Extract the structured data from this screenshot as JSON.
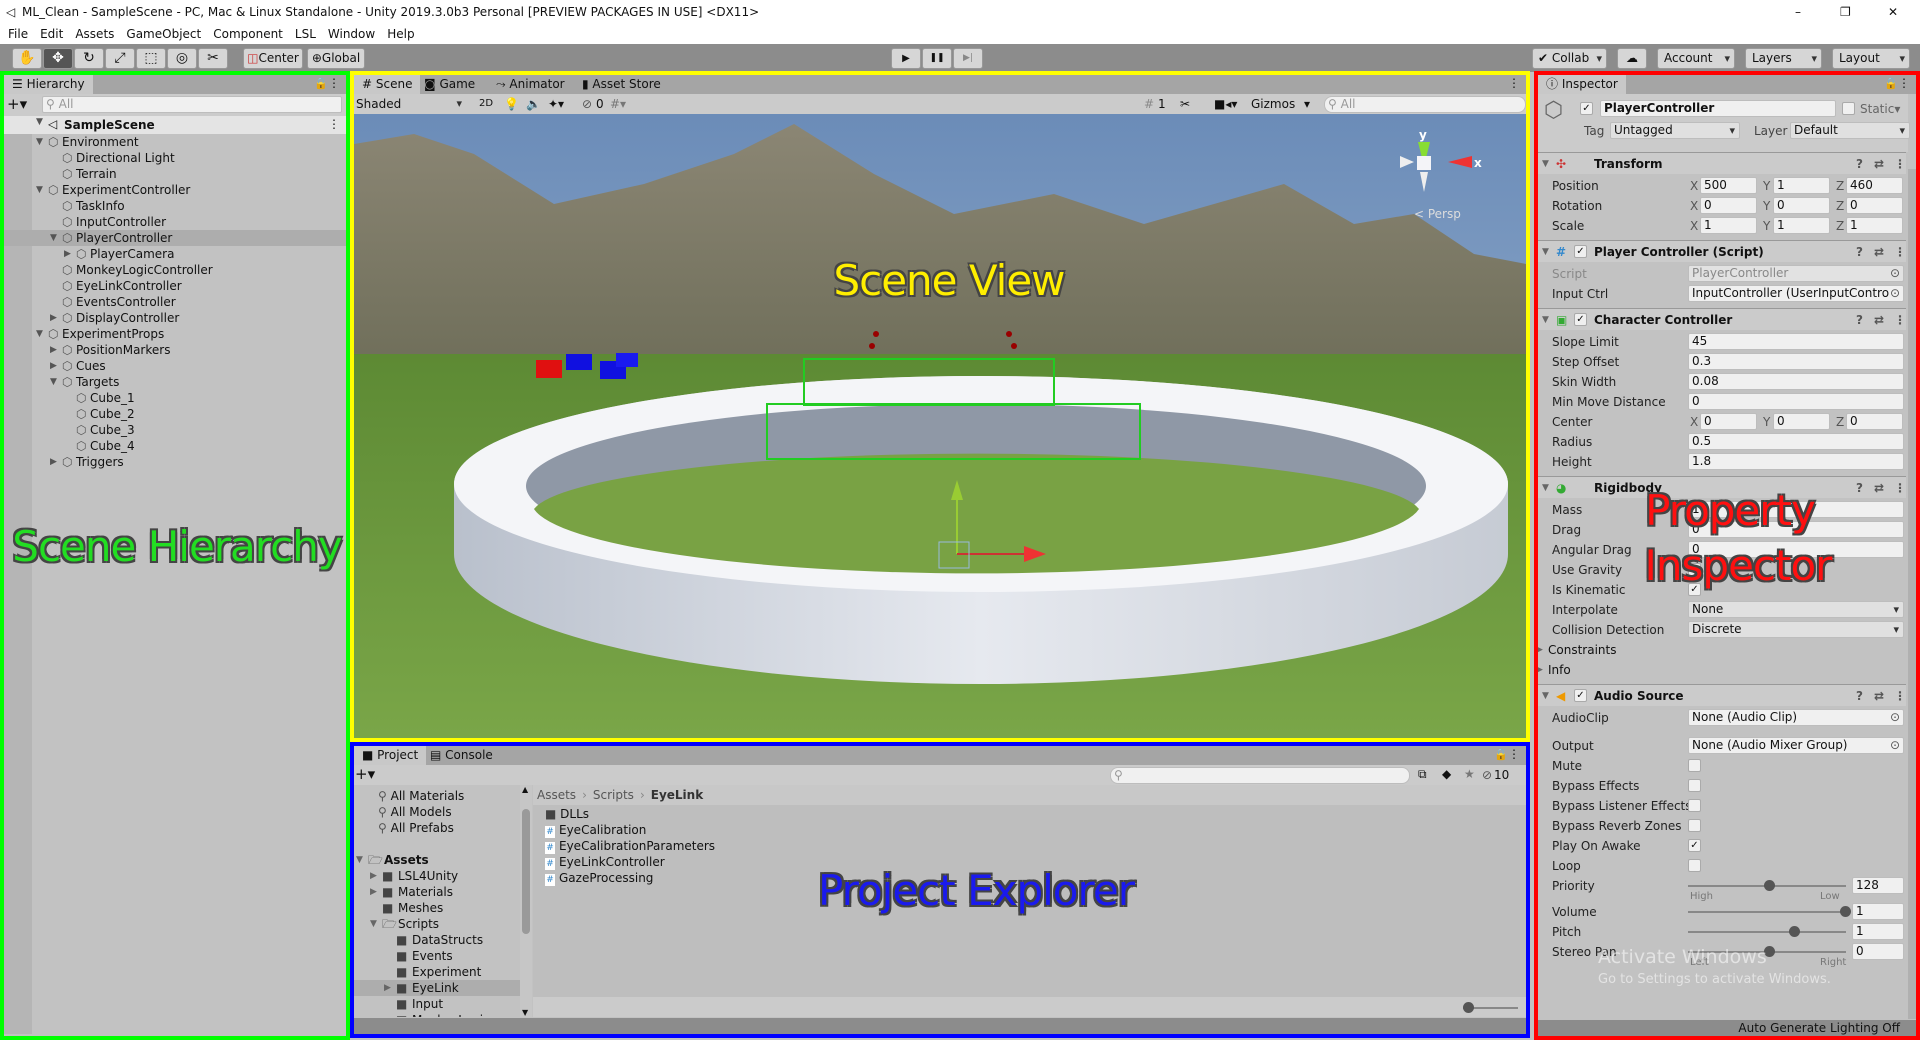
{
  "window": {
    "title": "ML_Clean - SampleScene - PC, Mac & Linux Standalone - Unity 2019.3.0b3 Personal [PREVIEW PACKAGES IN USE] <DX11>",
    "controls": [
      "–",
      "❐",
      "✕"
    ]
  },
  "menu": [
    "File",
    "Edit",
    "Assets",
    "GameObject",
    "Component",
    "LSL",
    "Window",
    "Help"
  ],
  "toolbar": {
    "tools": [
      {
        "icon": "hand-icon",
        "glyph": "✋"
      },
      {
        "icon": "move-icon",
        "glyph": "✥"
      },
      {
        "icon": "rotate-icon",
        "glyph": "↻"
      },
      {
        "icon": "scale-icon",
        "glyph": "⤢"
      },
      {
        "icon": "rect-icon",
        "glyph": "⬚"
      },
      {
        "icon": "transform-icon",
        "glyph": "◎"
      },
      {
        "icon": "custom-tool-icon",
        "glyph": "✂"
      }
    ],
    "pivot": "Center",
    "space": "Global",
    "play": "▶",
    "pause": "❚❚",
    "step": "▶|",
    "collab": "Collab",
    "account": "Account",
    "layers": "Layers",
    "layout": "Layout"
  },
  "hierarchy": {
    "tab": "Hierarchy",
    "search_placeholder": "All",
    "scene": "SampleScene",
    "items": [
      {
        "label": "Environment",
        "depth": 1,
        "arrow": "open"
      },
      {
        "label": "Directional Light",
        "depth": 2
      },
      {
        "label": "Terrain",
        "depth": 2
      },
      {
        "label": "ExperimentController",
        "depth": 1,
        "arrow": "open"
      },
      {
        "label": "TaskInfo",
        "depth": 2
      },
      {
        "label": "InputController",
        "depth": 2
      },
      {
        "label": "PlayerController",
        "depth": 2,
        "arrow": "open",
        "selected": true
      },
      {
        "label": "PlayerCamera",
        "depth": 3,
        "arrow": "closed"
      },
      {
        "label": "MonkeyLogicController",
        "depth": 2
      },
      {
        "label": "EyeLinkController",
        "depth": 2
      },
      {
        "label": "EventsController",
        "depth": 2
      },
      {
        "label": "DisplayController",
        "depth": 2,
        "arrow": "closed"
      },
      {
        "label": "ExperimentProps",
        "depth": 1,
        "arrow": "open"
      },
      {
        "label": "PositionMarkers",
        "depth": 2,
        "arrow": "closed"
      },
      {
        "label": "Cues",
        "depth": 2,
        "arrow": "closed"
      },
      {
        "label": "Targets",
        "depth": 2,
        "arrow": "open"
      },
      {
        "label": "Cube_1",
        "depth": 3
      },
      {
        "label": "Cube_2",
        "depth": 3
      },
      {
        "label": "Cube_3",
        "depth": 3
      },
      {
        "label": "Cube_4",
        "depth": 3
      },
      {
        "label": "Triggers",
        "depth": 2,
        "arrow": "closed"
      }
    ]
  },
  "scene": {
    "tabs": [
      "Scene",
      "Game",
      "Animator",
      "Asset Store"
    ],
    "active_tab": "Scene",
    "shading": "Shaded",
    "mode_2d": "2D",
    "hidden_count": "0",
    "grid_count": "1",
    "gizmos": "Gizmos",
    "search_placeholder": "All",
    "gizmo_axes": {
      "y": "y",
      "x": "x"
    },
    "projection": "< Persp"
  },
  "project": {
    "tabs": [
      "Project",
      "Console"
    ],
    "active_tab": "Project",
    "hidden_count": "10",
    "favorites": [
      "All Materials",
      "All Models",
      "All Prefabs"
    ],
    "tree": [
      {
        "label": "Assets",
        "depth": 0,
        "arrow": "open",
        "bold": true,
        "open": true
      },
      {
        "label": "LSL4Unity",
        "depth": 1,
        "arrow": "closed"
      },
      {
        "label": "Materials",
        "depth": 1,
        "arrow": "closed"
      },
      {
        "label": "Meshes",
        "depth": 1
      },
      {
        "label": "Scripts",
        "depth": 1,
        "arrow": "open",
        "open": true
      },
      {
        "label": "DataStructs",
        "depth": 2
      },
      {
        "label": "Events",
        "depth": 2
      },
      {
        "label": "Experiment",
        "depth": 2
      },
      {
        "label": "EyeLink",
        "depth": 2,
        "arrow": "closed",
        "selected": true
      },
      {
        "label": "Input",
        "depth": 2
      },
      {
        "label": "MonkeyLogic",
        "depth": 2
      }
    ],
    "breadcrumb": [
      "Assets",
      "Scripts",
      "EyeLink"
    ],
    "files": [
      {
        "label": "DLLs",
        "type": "folder"
      },
      {
        "label": "EyeCalibration",
        "type": "script"
      },
      {
        "label": "EyeCalibrationParameters",
        "type": "script"
      },
      {
        "label": "EyeLinkController",
        "type": "script"
      },
      {
        "label": "GazeProcessing",
        "type": "script"
      }
    ]
  },
  "inspector": {
    "tab": "Inspector",
    "object_name": "PlayerController",
    "active": true,
    "static_label": "Static",
    "tag_label": "Tag",
    "tag": "Untagged",
    "layer_label": "Layer",
    "layer": "Default",
    "components": [
      {
        "name": "Transform",
        "icon": "transform-icon",
        "rows": [
          {
            "label": "Position",
            "xyz": [
              "500",
              "1",
              "460"
            ]
          },
          {
            "label": "Rotation",
            "xyz": [
              "0",
              "0",
              "0"
            ]
          },
          {
            "label": "Scale",
            "xyz": [
              "1",
              "1",
              "1"
            ]
          }
        ]
      },
      {
        "name": "Player Controller (Script)",
        "icon": "script-icon",
        "check": true,
        "rows": [
          {
            "label": "Script",
            "obj": "PlayerController",
            "disabled": true
          },
          {
            "label": "Input Ctrl",
            "obj": "InputController (UserInputContro"
          }
        ]
      },
      {
        "name": "Character Controller",
        "icon": "character-controller-icon",
        "check": true,
        "rows": [
          {
            "label": "Slope Limit",
            "value": "45"
          },
          {
            "label": "Step Offset",
            "value": "0.3"
          },
          {
            "label": "Skin Width",
            "value": "0.08"
          },
          {
            "label": "Min Move Distance",
            "value": "0"
          },
          {
            "label": "Center",
            "xyz": [
              "0",
              "0",
              "0"
            ]
          },
          {
            "label": "Radius",
            "value": "0.5"
          },
          {
            "label": "Height",
            "value": "1.8"
          }
        ]
      },
      {
        "name": "Rigidbody",
        "icon": "rigidbody-icon",
        "rows": [
          {
            "label": "Mass",
            "value": "1"
          },
          {
            "label": "Drag",
            "value": "0"
          },
          {
            "label": "Angular Drag",
            "value": "0"
          },
          {
            "label": "Use Gravity",
            "bool": true
          },
          {
            "label": "Is Kinematic",
            "bool": true
          },
          {
            "label": "Interpolate",
            "select": "None"
          },
          {
            "label": "Collision Detection",
            "select": "Discrete"
          },
          {
            "label": "Constraints",
            "foldout": true
          },
          {
            "label": "Info",
            "foldout": true
          }
        ]
      },
      {
        "name": "Audio Source",
        "icon": "audio-source-icon",
        "check": true,
        "rows": [
          {
            "label": "AudioClip",
            "obj": "None (Audio Clip)"
          },
          {
            "label": "Output",
            "obj": "None (Audio Mixer Group)"
          },
          {
            "label": "Mute",
            "bool": false
          },
          {
            "label": "Bypass Effects",
            "bool": false
          },
          {
            "label": "Bypass Listener Effects",
            "bool": false
          },
          {
            "label": "Bypass Reverb Zones",
            "bool": false
          },
          {
            "label": "Play On Awake",
            "bool": true
          },
          {
            "label": "Loop",
            "bool": false
          },
          {
            "label": "Priority",
            "slider": 128,
            "min": 0,
            "max": 256,
            "value": "128",
            "left": "High",
            "right": "Low"
          },
          {
            "label": "Volume",
            "slider": 1,
            "min": 0,
            "max": 1,
            "value": "1"
          },
          {
            "label": "Pitch",
            "slider": 1,
            "min": -3,
            "max": 3,
            "value": "1"
          },
          {
            "label": "Stereo Pan",
            "slider": 0,
            "min": -1,
            "max": 1,
            "value": "0",
            "left": "Left",
            "right": "Right"
          }
        ]
      }
    ]
  },
  "status": {
    "lighting": "Auto Generate Lighting Off"
  },
  "watermark": {
    "title": "Activate Windows",
    "subtitle": "Go to Settings to activate Windows."
  },
  "annotations": {
    "hierarchy": "Scene Hierarchy",
    "scene": "Scene View",
    "project": "Project Explorer",
    "inspector_line1": "Property",
    "inspector_line2": "Inspector"
  },
  "colors": {
    "hierarchy": "#00ff00",
    "scene": "#ffff00",
    "project": "#0000ff",
    "inspector": "#ff0000"
  }
}
